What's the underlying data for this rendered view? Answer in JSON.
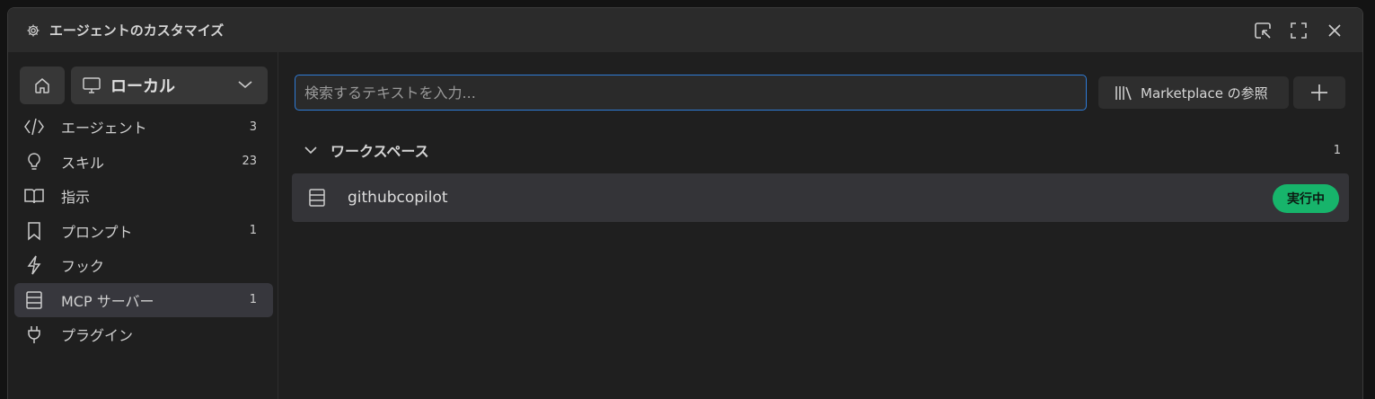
{
  "window": {
    "title": "エージェントのカスタマイズ",
    "title_icon": "gear-icon",
    "actions": [
      "open-in-editor-icon",
      "maximize-icon",
      "close-icon"
    ]
  },
  "sidebar": {
    "location": {
      "label": "ローカル",
      "icon": "monitor-icon"
    },
    "items": [
      {
        "label": "エージェント",
        "count": "3",
        "icon": "code-icon"
      },
      {
        "label": "スキル",
        "count": "23",
        "icon": "lightbulb-icon"
      },
      {
        "label": "指示",
        "count": "",
        "icon": "book-icon"
      },
      {
        "label": "プロンプト",
        "count": "1",
        "icon": "bookmark-icon"
      },
      {
        "label": "フック",
        "count": "",
        "icon": "lightning-icon"
      },
      {
        "label": "MCP サーバー",
        "count": "1",
        "icon": "server-icon",
        "active": true
      },
      {
        "label": "プラグイン",
        "count": "",
        "icon": "plug-icon"
      }
    ]
  },
  "main": {
    "search": {
      "placeholder": "検索するテキストを入力...",
      "value": ""
    },
    "marketplace_label": "Marketplace の参照",
    "section": {
      "label": "ワークスペース",
      "count": "1"
    },
    "servers": [
      {
        "name": "githubcopilot",
        "status": "実行中",
        "status_color": "#17b46b"
      }
    ]
  },
  "colors": {
    "accent": "#2f7bd6",
    "background": "#1f1f1f",
    "titlebar": "#2b2b2b",
    "running": "#17b46b"
  }
}
